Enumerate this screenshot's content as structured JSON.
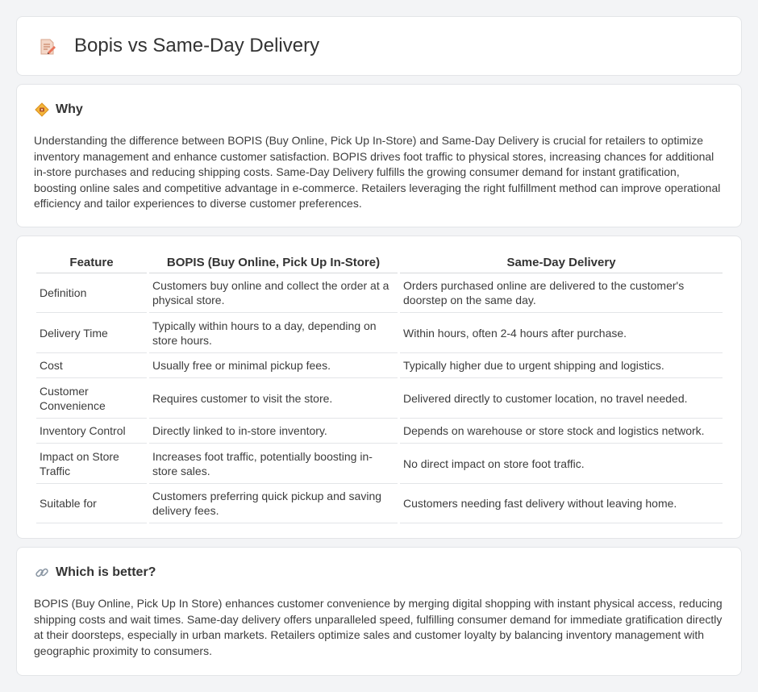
{
  "header": {
    "title": "Bopis vs Same-Day Delivery",
    "icon": "document-pencil-icon"
  },
  "why": {
    "title": "Why",
    "icon": "diamond-warning-icon",
    "text": "Understanding the difference between BOPIS (Buy Online, Pick Up In-Store) and Same-Day Delivery is crucial for retailers to optimize inventory management and enhance customer satisfaction. BOPIS drives foot traffic to physical stores, increasing chances for additional in-store purchases and reducing shipping costs. Same-Day Delivery fulfills the growing consumer demand for instant gratification, boosting online sales and competitive advantage in e-commerce. Retailers leveraging the right fulfillment method can improve operational efficiency and tailor experiences to diverse customer preferences."
  },
  "table": {
    "headers": [
      "Feature",
      "BOPIS (Buy Online, Pick Up In-Store)",
      "Same-Day Delivery"
    ],
    "rows": [
      [
        "Definition",
        "Customers buy online and collect the order at a physical store.",
        "Orders purchased online are delivered to the customer's doorstep on the same day."
      ],
      [
        "Delivery Time",
        "Typically within hours to a day, depending on store hours.",
        "Within hours, often 2-4 hours after purchase."
      ],
      [
        "Cost",
        "Usually free or minimal pickup fees.",
        "Typically higher due to urgent shipping and logistics."
      ],
      [
        "Customer Convenience",
        "Requires customer to visit the store.",
        "Delivered directly to customer location, no travel needed."
      ],
      [
        "Inventory Control",
        "Directly linked to in-store inventory.",
        "Depends on warehouse or store stock and logistics network."
      ],
      [
        "Impact on Store Traffic",
        "Increases foot traffic, potentially boosting in-store sales.",
        "No direct impact on store foot traffic."
      ],
      [
        "Suitable for",
        "Customers preferring quick pickup and saving delivery fees.",
        "Customers needing fast delivery without leaving home."
      ]
    ]
  },
  "better": {
    "title": "Which is better?",
    "icon": "link-icon",
    "text": "BOPIS (Buy Online, Pick Up In Store) enhances customer convenience by merging digital shopping with instant physical access, reducing shipping costs and wait times. Same-day delivery offers unparalleled speed, fulfilling consumer demand for immediate gratification directly at their doorsteps, especially in urban markets. Retailers optimize sales and customer loyalty by balancing inventory management with geographic proximity to consumers."
  }
}
